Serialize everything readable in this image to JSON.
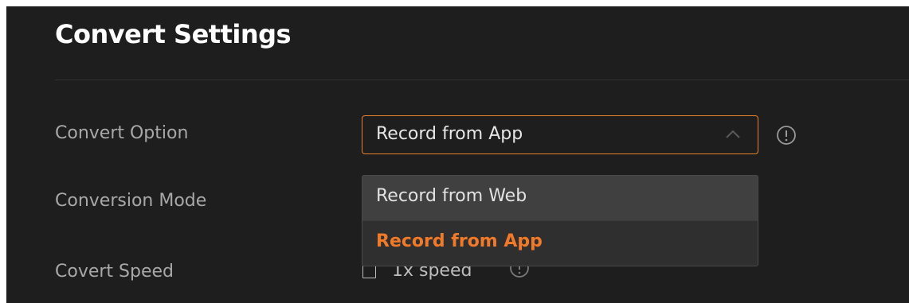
{
  "settings": {
    "title": "Convert Settings",
    "convert_option": {
      "label": "Convert Option",
      "selected_value": "Record from App",
      "options": [
        "Record from Web",
        "Record from App"
      ],
      "info_icon": "info-circle-icon",
      "chevron_icon": "chevron-up-icon"
    },
    "conversion_mode": {
      "label": "Conversion Mode"
    },
    "convert_speed": {
      "label": "Covert Speed",
      "checkbox_label": "1x speed",
      "checked": false,
      "info_icon": "info-circle-icon"
    }
  },
  "colors": {
    "background": "#1e1e1e",
    "accent": "#f07a2a",
    "select_border": "#e8812e",
    "dropdown_bg": "#3c3c3c",
    "text": "#e6e6e6",
    "muted_text": "#a8a8a8"
  }
}
